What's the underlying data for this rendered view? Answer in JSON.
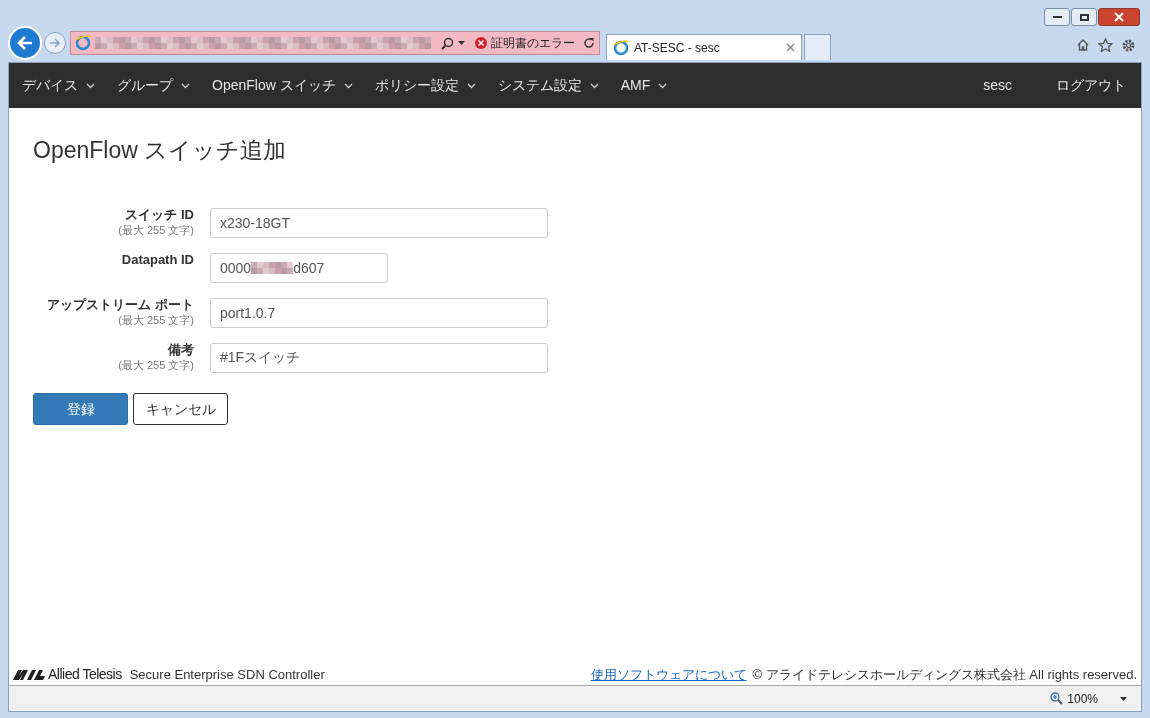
{
  "browser": {
    "address_error": "証明書のエラー",
    "tab": {
      "title": "AT-SESC - sesc",
      "selected": true
    }
  },
  "navbar": {
    "menus": [
      {
        "label": "デバイス"
      },
      {
        "label": "グループ"
      },
      {
        "label": "OpenFlow スイッチ"
      },
      {
        "label": "ポリシー設定"
      },
      {
        "label": "システム設定"
      },
      {
        "label": "AMF"
      }
    ],
    "user": "sesc",
    "logout": "ログアウト"
  },
  "page_title": "OpenFlow スイッチ追加",
  "form": {
    "fields": [
      {
        "kind": "text",
        "label": "スイッチ ID",
        "hint": "(最大 255 文字)",
        "value": "x230-18GT"
      },
      {
        "kind": "masked",
        "label": "Datapath ID",
        "value_start": "0000",
        "value_end": "d607"
      },
      {
        "kind": "text",
        "label": "アップストリーム ポート",
        "hint": "(最大 255 文字)",
        "value": "port1.0.7"
      },
      {
        "kind": "text",
        "label": "備考",
        "hint": "(最大 255 文字)",
        "value": "#1Fスイッチ"
      }
    ],
    "submit": "登録",
    "cancel": "キャンセル"
  },
  "footer": {
    "brand": "Allied Telesis",
    "product": "Secure Enterprise SDN Controller",
    "link": "使用ソフトウェアについて",
    "copyright": "© アライドテレシスホールディングス株式会社 All rights reserved."
  },
  "status_bar": {
    "zoom": "100%"
  }
}
